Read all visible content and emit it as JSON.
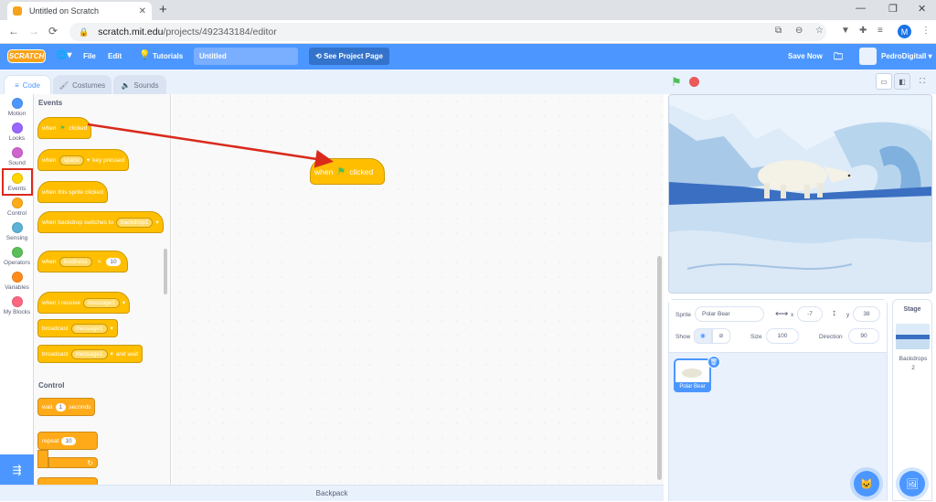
{
  "browser": {
    "tab_title": "Untitled on Scratch",
    "tab_close": "✕",
    "new_tab": "+",
    "minimize": "—",
    "maximize": "❐",
    "close": "✕",
    "back": "←",
    "forward": "→",
    "reload": "⟳",
    "lock": "🔒",
    "url_host": "scratch.mit.edu",
    "url_path": "/projects/492343184/editor",
    "profile_initial": "M"
  },
  "menu": {
    "logo": "SCRATCH",
    "globe": "🌐▾",
    "file": "File",
    "edit": "Edit",
    "tutorials": "Tutorials",
    "project_title": "Untitled",
    "see_project": "⟲  See Project Page",
    "save_now": "Save Now",
    "username": "PedroDigitalI ▾"
  },
  "editor_tabs": {
    "code": "Code",
    "costumes": "Costumes",
    "sounds": "Sounds"
  },
  "categories": [
    {
      "label": "Motion",
      "color": "#4c97ff"
    },
    {
      "label": "Looks",
      "color": "#9966ff"
    },
    {
      "label": "Sound",
      "color": "#cf63cf"
    },
    {
      "label": "Events",
      "color": "#ffd500"
    },
    {
      "label": "Control",
      "color": "#ffab19"
    },
    {
      "label": "Sensing",
      "color": "#5cb1d6"
    },
    {
      "label": "Operators",
      "color": "#59c059"
    },
    {
      "label": "Variables",
      "color": "#ff8c1a"
    },
    {
      "label": "My Blocks",
      "color": "#ff6680"
    }
  ],
  "palette": {
    "events_heading": "Events",
    "control_heading": "Control",
    "when": "when",
    "clicked": "clicked",
    "key_pressed": "key pressed",
    "space": "space",
    "when_sprite_clicked": "when this sprite clicked",
    "when_backdrop": "when backdrop switches to",
    "backdrop1": "backdrop1",
    "loudness": "loudness",
    "gt": ">",
    "loud_val": "10",
    "when_receive": "when I receive",
    "message1": "message1",
    "broadcast": "broadcast",
    "and_wait": "and wait",
    "wait": "wait",
    "wait_val": "1",
    "seconds": "seconds",
    "repeat": "repeat",
    "repeat_val": "10"
  },
  "canvas_block": {
    "when": "when",
    "clicked": "clicked"
  },
  "backpack": "Backpack",
  "sprite_info": {
    "sprite_label": "Sprite",
    "sprite_name": "Polar Bear",
    "x_label": "x",
    "x_val": "-7",
    "y_label": "y",
    "y_val": "38",
    "show_label": "Show",
    "size_label": "Size",
    "size_val": "100",
    "direction_label": "Direction",
    "direction_val": "90"
  },
  "sprite_thumb_label": "Polar Bear",
  "stage_pane": {
    "title": "Stage",
    "backdrops_label": "Backdrops",
    "backdrops_count": "2"
  }
}
